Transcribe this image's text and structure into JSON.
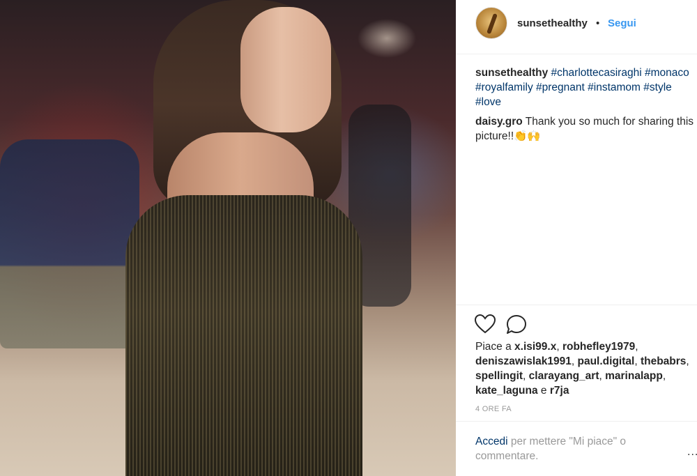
{
  "post": {
    "author": "sunsethealthy",
    "separator": "•",
    "follow_label": "Segui"
  },
  "caption": {
    "author": "sunsethealthy",
    "hashtags": [
      "#charlottecasiraghi",
      "#monaco",
      "#royalfamily",
      "#pregnant",
      "#instamom",
      "#style",
      "#love"
    ]
  },
  "comment": {
    "author": "daisy.gro",
    "text": "Thank you so much for sharing this picture!!👏🙌"
  },
  "actions": {
    "like_icon": "heart-icon",
    "comment_icon": "comment-bubble-icon"
  },
  "likes": {
    "prefix": "Piace a",
    "users": [
      "x.isi99.x",
      "robhefley1979",
      "deniszawislak1991",
      "paul.digital",
      "thebabrs",
      "spellingit",
      "clarayang_art",
      "marinalapp",
      "kate_laguna"
    ],
    "conjunction": "e",
    "last_user": "r7ja"
  },
  "timestamp": "4 ORE FA",
  "login": {
    "link_label": "Accedi",
    "rest": "per mettere \"Mi piace\" o commentare."
  },
  "more_label": "..."
}
